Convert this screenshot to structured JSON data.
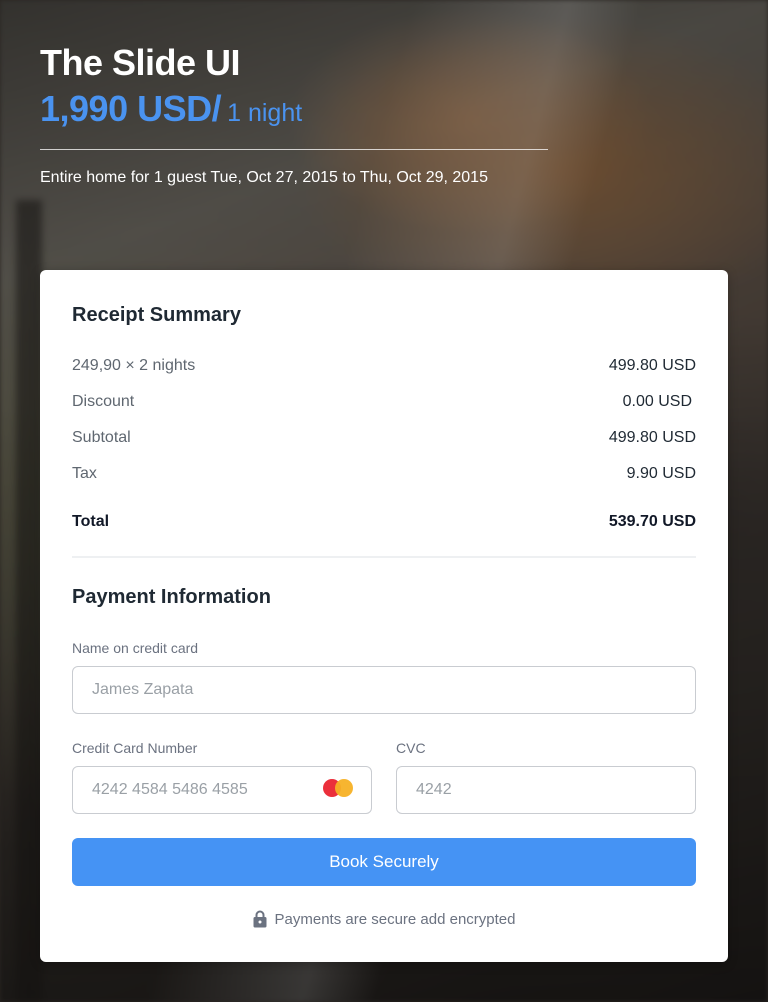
{
  "hero": {
    "title": "The Slide UI",
    "price": "1,990 USD/",
    "price_unit": "1 night",
    "subtitle": "Entire home for 1 guest Tue, Oct 27, 2015 to Thu, Oct 29, 2015"
  },
  "receipt": {
    "title": "Receipt Summary",
    "items": [
      {
        "label": "249,90 × 2 nights",
        "value": "499.80 USD"
      },
      {
        "label": "Discount",
        "value": "0.00 USD"
      },
      {
        "label": "Subtotal",
        "value": "499.80 USD"
      },
      {
        "label": "Tax",
        "value": "9.90 USD"
      }
    ],
    "total": {
      "label": "Total",
      "value": "539.70 USD"
    }
  },
  "payment": {
    "title": "Payment Information",
    "name_label": "Name on credit card",
    "name_placeholder": "James Zapata",
    "card_label": "Credit Card Number",
    "card_placeholder": "4242 4584 5486 4585",
    "cvc_label": "CVC",
    "cvc_placeholder": "4242",
    "card_brand_icon": "mastercard-icon",
    "submit_label": "Book Securely",
    "secure_note": "Payments are secure add encrypted",
    "secure_icon": "lock-icon"
  },
  "colors": {
    "accent": "#4593f4",
    "price": "#4a93f0",
    "card_background": "#ffffff"
  }
}
